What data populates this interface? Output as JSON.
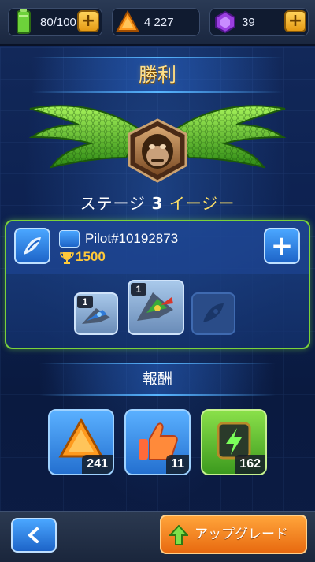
{
  "resources": {
    "energy": "80/100",
    "crystals": "4 227",
    "gems": "39",
    "plus_label": "+"
  },
  "title": "勝利",
  "stage": {
    "prefix": "ステージ",
    "number": "3",
    "difficulty": "イージー"
  },
  "pilot": {
    "name": "Pilot#10192873",
    "trophies": "1500",
    "add_label": "+"
  },
  "ships": [
    {
      "level": "1"
    },
    {
      "level": "1"
    }
  ],
  "rewards": {
    "title": "報酬",
    "items": [
      {
        "icon": "crystal-icon",
        "count": "241"
      },
      {
        "icon": "thumbs-up-icon",
        "count": "11"
      },
      {
        "icon": "energy-chip-icon",
        "count": "162"
      }
    ]
  },
  "bottom": {
    "back_label": "<",
    "upgrade_label": "アップグレード"
  },
  "colors": {
    "panel_border": "#7ad23a",
    "title_gold": "#ffe08a",
    "upgrade_orange": "#f28a22"
  }
}
